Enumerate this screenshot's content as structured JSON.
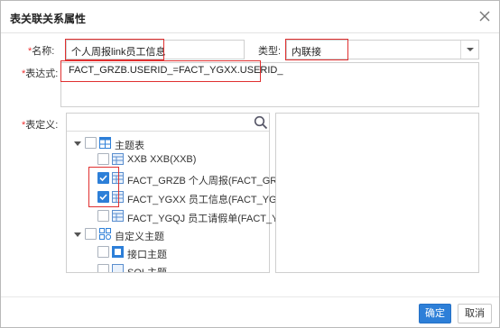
{
  "dialog": {
    "title": "表关联关系属性",
    "close_icon": "close-icon"
  },
  "form": {
    "name_label": "名称:",
    "name_value": "个人周报link员工信息",
    "type_label": "类型:",
    "type_value": "内联接",
    "expr_label": "表达式:",
    "expr_value": "FACT_GRZB.USERID_=FACT_YGXX.USERID_",
    "def_label": "表定义:",
    "required_mark": "*"
  },
  "tree": {
    "search_value": "",
    "nodes": [
      {
        "label": "主题表",
        "expanded": true,
        "checked": false,
        "icon": "table-group-icon"
      },
      {
        "label": "XXB XXB(XXB)",
        "checked": false,
        "icon": "table-icon"
      },
      {
        "label": "FACT_GRZB 个人周报(FACT_GRZB)",
        "checked": true,
        "icon": "table-icon"
      },
      {
        "label": "FACT_YGXX 员工信息(FACT_YGXX)",
        "checked": true,
        "icon": "table-icon"
      },
      {
        "label": "FACT_YGQJ 员工请假单(FACT_YGQ",
        "checked": false,
        "icon": "table-icon"
      },
      {
        "label": "自定义主题",
        "expanded": true,
        "checked": false,
        "icon": "custom-theme-icon"
      },
      {
        "label": "接口主题",
        "checked": false,
        "icon": "interface-icon"
      },
      {
        "label": "SQL主题",
        "checked": false,
        "icon": "sql-icon"
      }
    ]
  },
  "footer": {
    "ok_label": "确定",
    "cancel_label": "取消"
  },
  "colors": {
    "accent": "#2d7fd8",
    "highlight_border": "#e03030"
  }
}
